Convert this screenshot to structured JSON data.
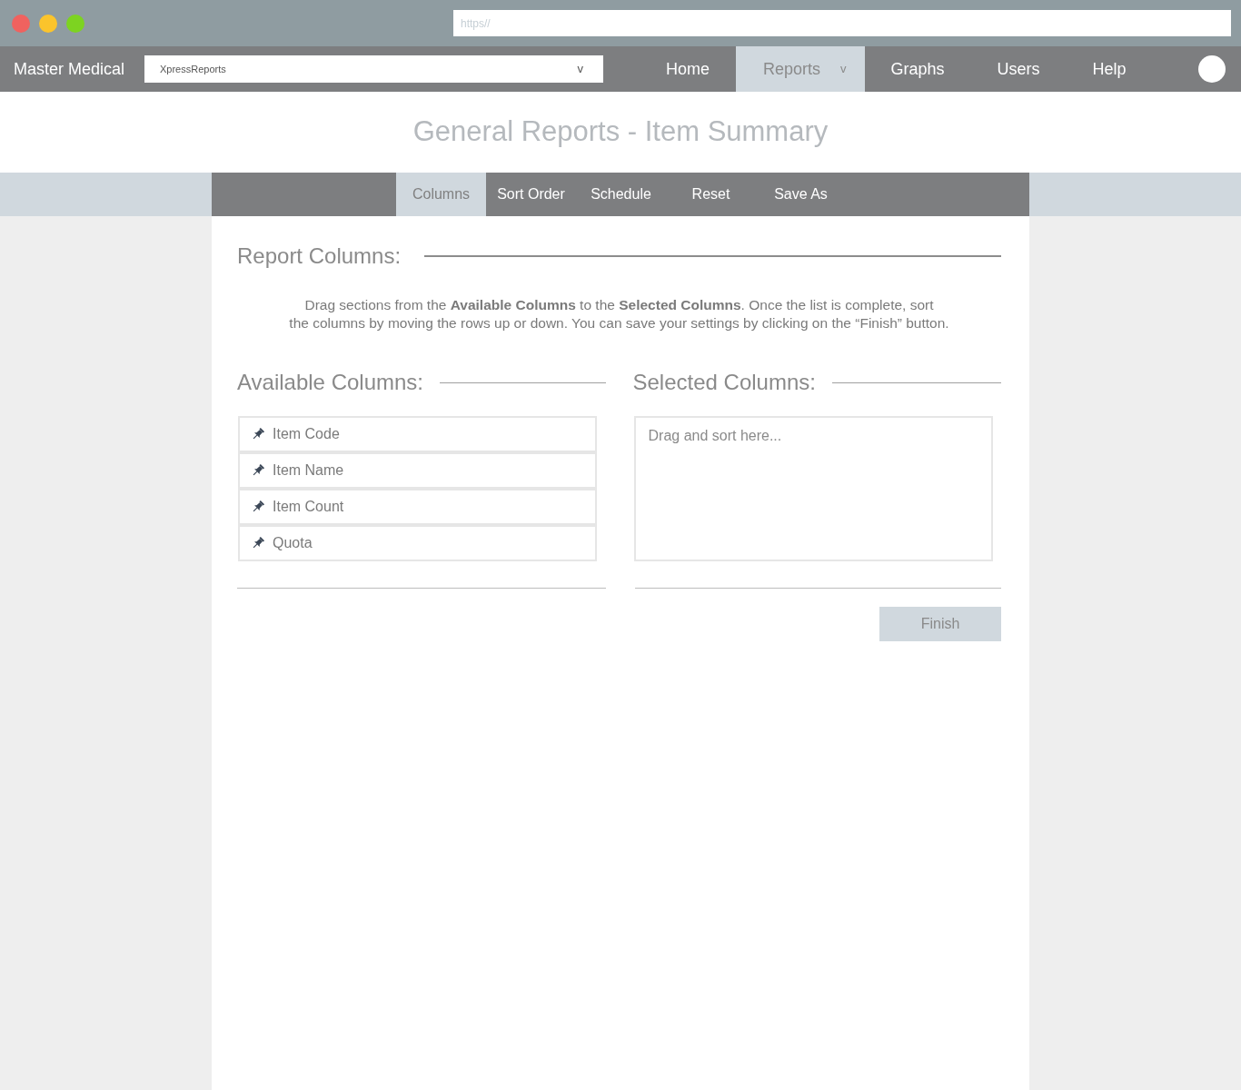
{
  "browser": {
    "traffic_lights": [
      {
        "color": "#f0625f"
      },
      {
        "color": "#fbc42c"
      },
      {
        "color": "#7dd321"
      }
    ],
    "address_bar": {
      "placeholder": "https//"
    }
  },
  "navbar": {
    "brand": "Master Medical",
    "app_select": {
      "value": "XpressReports",
      "caret": "v"
    },
    "items": [
      {
        "label": "Home",
        "selected": false
      },
      {
        "label": "Reports",
        "selected": true,
        "caret": "v"
      },
      {
        "label": "Graphs",
        "selected": false
      },
      {
        "label": "Users",
        "selected": false
      },
      {
        "label": "Help",
        "selected": false
      }
    ]
  },
  "page_title": "General Reports - Item Summary",
  "toolbar": {
    "tabs": [
      {
        "label": "Columns",
        "selected": true
      },
      {
        "label": "Sort Order",
        "selected": false
      },
      {
        "label": "Schedule",
        "selected": false
      },
      {
        "label": "Reset",
        "selected": false
      },
      {
        "label": "Save As",
        "selected": false
      }
    ]
  },
  "section": {
    "title": "Report Columns:",
    "instructions": "Drag sections from the **Available Columns** to the **Selected Columns**. Once the list is complete, sort\nthe columns by moving the rows up or down. You can save your settings by clicking on the “Finish” button."
  },
  "available_columns": {
    "title": "Available Columns:",
    "items": [
      {
        "label": "Item Code"
      },
      {
        "label": "Item Name"
      },
      {
        "label": "Item Count"
      },
      {
        "label": "Quota"
      }
    ]
  },
  "selected_columns": {
    "title": "Selected Columns:",
    "placeholder": "Drag and sort here..."
  },
  "finish_button": {
    "label": "Finish",
    "disabled": true
  }
}
